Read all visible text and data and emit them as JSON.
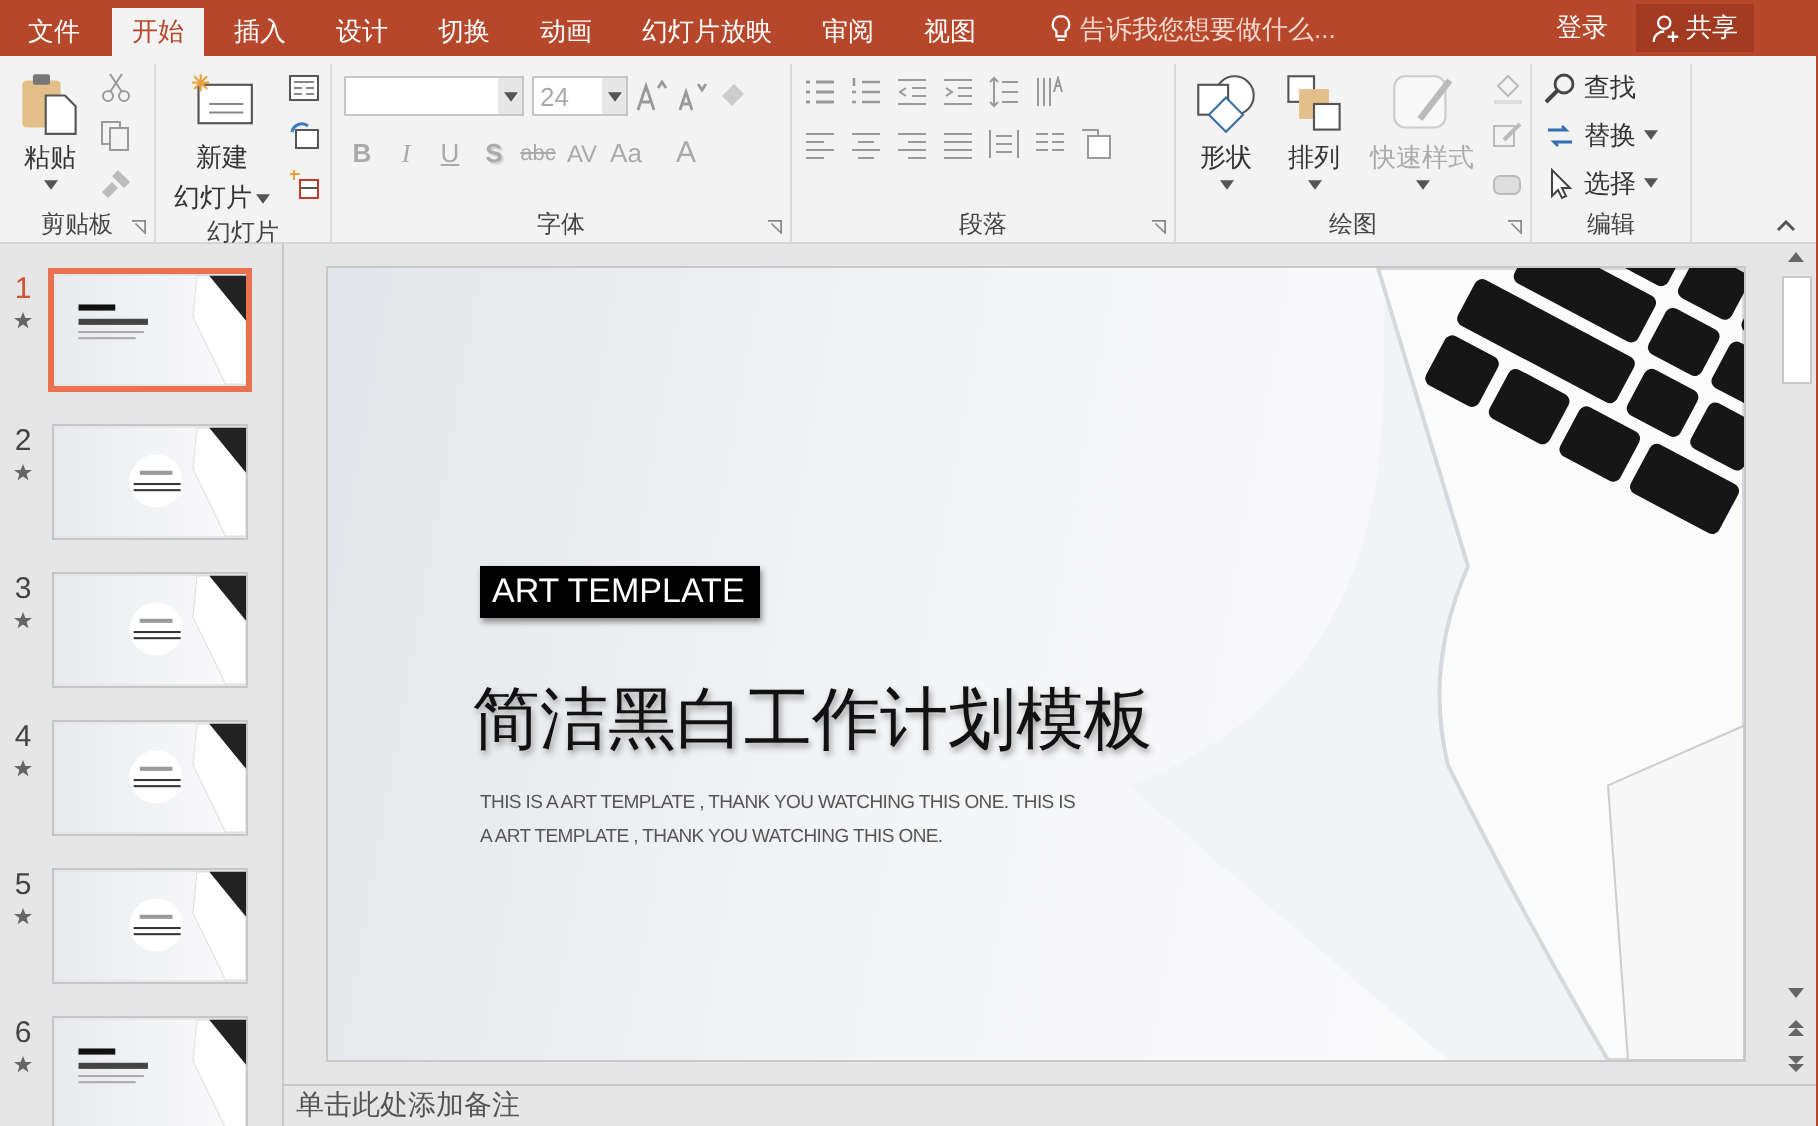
{
  "tabs": [
    {
      "label": "文件",
      "kind": "file",
      "selected": false
    },
    {
      "label": "开始",
      "kind": "tab",
      "selected": true
    },
    {
      "label": "插入",
      "kind": "tab",
      "selected": false
    },
    {
      "label": "设计",
      "kind": "tab",
      "selected": false
    },
    {
      "label": "切换",
      "kind": "tab",
      "selected": false
    },
    {
      "label": "动画",
      "kind": "tab",
      "selected": false
    },
    {
      "label": "幻灯片放映",
      "kind": "tab",
      "selected": false
    },
    {
      "label": "审阅",
      "kind": "tab",
      "selected": false
    },
    {
      "label": "视图",
      "kind": "tab",
      "selected": false
    }
  ],
  "tell_me": {
    "placeholder": "告诉我您想要做什么..."
  },
  "account": {
    "sign_in": "登录",
    "share": "共享"
  },
  "ribbon": {
    "clipboard": {
      "label": "剪贴板",
      "paste": "粘贴"
    },
    "slides": {
      "label": "幻灯片",
      "new_slide_line1": "新建",
      "new_slide_line2": "幻灯片"
    },
    "font": {
      "label": "字体",
      "size": "24",
      "disabled": true,
      "buttons": [
        {
          "kind": "bold",
          "text": "B"
        },
        {
          "kind": "italic",
          "text": "I"
        },
        {
          "kind": "underline",
          "text": "U"
        },
        {
          "kind": "shadow",
          "text": "S"
        },
        {
          "kind": "strike",
          "text": "abc"
        },
        {
          "kind": "spacing",
          "text": "AV"
        },
        {
          "kind": "case",
          "text": "Aa"
        },
        {
          "kind": "color",
          "text": "A"
        }
      ]
    },
    "paragraph": {
      "label": "段落"
    },
    "drawing": {
      "label": "绘图",
      "buttons": [
        {
          "label": "形状",
          "kind": "shape",
          "disabled": false
        },
        {
          "label": "排列",
          "kind": "arrange",
          "disabled": false
        },
        {
          "label": "快速样式",
          "kind": "style",
          "disabled": true
        }
      ]
    },
    "editing": {
      "label": "编辑",
      "items": [
        {
          "label": "查找",
          "kind": "find"
        },
        {
          "label": "替换",
          "kind": "replace"
        },
        {
          "label": "选择",
          "kind": "select"
        }
      ]
    }
  },
  "slides": [
    {
      "number": "1",
      "kind": "title",
      "selected": true
    },
    {
      "number": "2",
      "kind": "section",
      "selected": false
    },
    {
      "number": "3",
      "kind": "section",
      "selected": false
    },
    {
      "number": "4",
      "kind": "section",
      "selected": false
    },
    {
      "number": "5",
      "kind": "section",
      "selected": false
    },
    {
      "number": "6",
      "kind": "title",
      "selected": false
    }
  ],
  "slide": {
    "tag": "ART TEMPLATE",
    "title": "简洁黑白工作计划模板",
    "subtitle": "THIS IS A ART TEMPLATE , THANK YOU WATCHING THIS ONE. THIS IS A ART TEMPLATE , THANK YOU WATCHING THIS ONE."
  },
  "notes": {
    "placeholder": "单击此处添加备注"
  }
}
